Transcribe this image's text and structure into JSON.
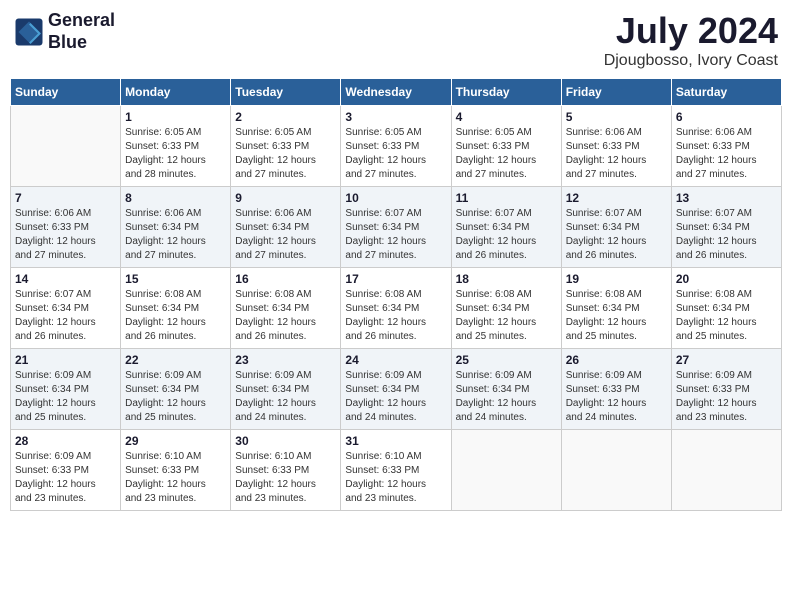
{
  "header": {
    "logo_line1": "General",
    "logo_line2": "Blue",
    "month_year": "July 2024",
    "location": "Djougbosso, Ivory Coast"
  },
  "days_of_week": [
    "Sunday",
    "Monday",
    "Tuesday",
    "Wednesday",
    "Thursday",
    "Friday",
    "Saturday"
  ],
  "weeks": [
    [
      {
        "day": "",
        "info": ""
      },
      {
        "day": "1",
        "info": "Sunrise: 6:05 AM\nSunset: 6:33 PM\nDaylight: 12 hours\nand 28 minutes."
      },
      {
        "day": "2",
        "info": "Sunrise: 6:05 AM\nSunset: 6:33 PM\nDaylight: 12 hours\nand 27 minutes."
      },
      {
        "day": "3",
        "info": "Sunrise: 6:05 AM\nSunset: 6:33 PM\nDaylight: 12 hours\nand 27 minutes."
      },
      {
        "day": "4",
        "info": "Sunrise: 6:05 AM\nSunset: 6:33 PM\nDaylight: 12 hours\nand 27 minutes."
      },
      {
        "day": "5",
        "info": "Sunrise: 6:06 AM\nSunset: 6:33 PM\nDaylight: 12 hours\nand 27 minutes."
      },
      {
        "day": "6",
        "info": "Sunrise: 6:06 AM\nSunset: 6:33 PM\nDaylight: 12 hours\nand 27 minutes."
      }
    ],
    [
      {
        "day": "7",
        "info": "Sunrise: 6:06 AM\nSunset: 6:33 PM\nDaylight: 12 hours\nand 27 minutes."
      },
      {
        "day": "8",
        "info": "Sunrise: 6:06 AM\nSunset: 6:34 PM\nDaylight: 12 hours\nand 27 minutes."
      },
      {
        "day": "9",
        "info": "Sunrise: 6:06 AM\nSunset: 6:34 PM\nDaylight: 12 hours\nand 27 minutes."
      },
      {
        "day": "10",
        "info": "Sunrise: 6:07 AM\nSunset: 6:34 PM\nDaylight: 12 hours\nand 27 minutes."
      },
      {
        "day": "11",
        "info": "Sunrise: 6:07 AM\nSunset: 6:34 PM\nDaylight: 12 hours\nand 26 minutes."
      },
      {
        "day": "12",
        "info": "Sunrise: 6:07 AM\nSunset: 6:34 PM\nDaylight: 12 hours\nand 26 minutes."
      },
      {
        "day": "13",
        "info": "Sunrise: 6:07 AM\nSunset: 6:34 PM\nDaylight: 12 hours\nand 26 minutes."
      }
    ],
    [
      {
        "day": "14",
        "info": "Sunrise: 6:07 AM\nSunset: 6:34 PM\nDaylight: 12 hours\nand 26 minutes."
      },
      {
        "day": "15",
        "info": "Sunrise: 6:08 AM\nSunset: 6:34 PM\nDaylight: 12 hours\nand 26 minutes."
      },
      {
        "day": "16",
        "info": "Sunrise: 6:08 AM\nSunset: 6:34 PM\nDaylight: 12 hours\nand 26 minutes."
      },
      {
        "day": "17",
        "info": "Sunrise: 6:08 AM\nSunset: 6:34 PM\nDaylight: 12 hours\nand 26 minutes."
      },
      {
        "day": "18",
        "info": "Sunrise: 6:08 AM\nSunset: 6:34 PM\nDaylight: 12 hours\nand 25 minutes."
      },
      {
        "day": "19",
        "info": "Sunrise: 6:08 AM\nSunset: 6:34 PM\nDaylight: 12 hours\nand 25 minutes."
      },
      {
        "day": "20",
        "info": "Sunrise: 6:08 AM\nSunset: 6:34 PM\nDaylight: 12 hours\nand 25 minutes."
      }
    ],
    [
      {
        "day": "21",
        "info": "Sunrise: 6:09 AM\nSunset: 6:34 PM\nDaylight: 12 hours\nand 25 minutes."
      },
      {
        "day": "22",
        "info": "Sunrise: 6:09 AM\nSunset: 6:34 PM\nDaylight: 12 hours\nand 25 minutes."
      },
      {
        "day": "23",
        "info": "Sunrise: 6:09 AM\nSunset: 6:34 PM\nDaylight: 12 hours\nand 24 minutes."
      },
      {
        "day": "24",
        "info": "Sunrise: 6:09 AM\nSunset: 6:34 PM\nDaylight: 12 hours\nand 24 minutes."
      },
      {
        "day": "25",
        "info": "Sunrise: 6:09 AM\nSunset: 6:34 PM\nDaylight: 12 hours\nand 24 minutes."
      },
      {
        "day": "26",
        "info": "Sunrise: 6:09 AM\nSunset: 6:33 PM\nDaylight: 12 hours\nand 24 minutes."
      },
      {
        "day": "27",
        "info": "Sunrise: 6:09 AM\nSunset: 6:33 PM\nDaylight: 12 hours\nand 23 minutes."
      }
    ],
    [
      {
        "day": "28",
        "info": "Sunrise: 6:09 AM\nSunset: 6:33 PM\nDaylight: 12 hours\nand 23 minutes."
      },
      {
        "day": "29",
        "info": "Sunrise: 6:10 AM\nSunset: 6:33 PM\nDaylight: 12 hours\nand 23 minutes."
      },
      {
        "day": "30",
        "info": "Sunrise: 6:10 AM\nSunset: 6:33 PM\nDaylight: 12 hours\nand 23 minutes."
      },
      {
        "day": "31",
        "info": "Sunrise: 6:10 AM\nSunset: 6:33 PM\nDaylight: 12 hours\nand 23 minutes."
      },
      {
        "day": "",
        "info": ""
      },
      {
        "day": "",
        "info": ""
      },
      {
        "day": "",
        "info": ""
      }
    ]
  ]
}
